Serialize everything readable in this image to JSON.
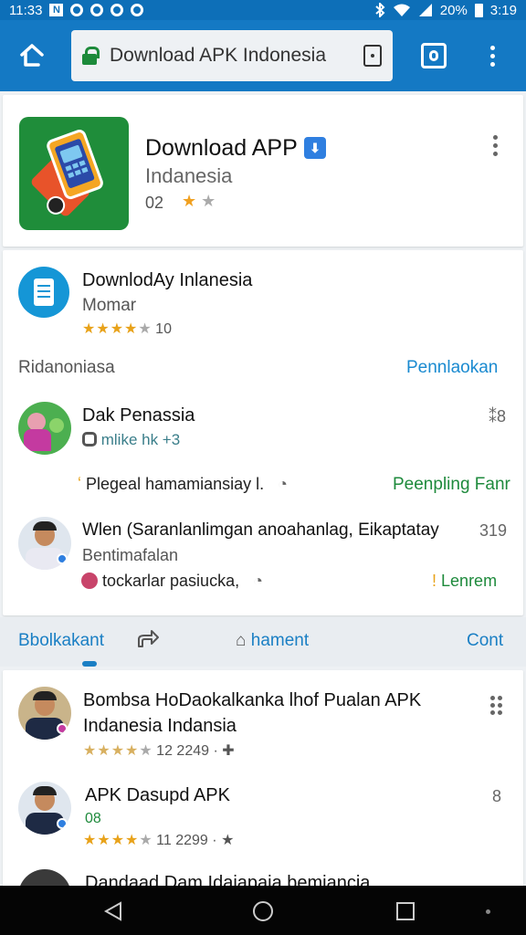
{
  "status_bar": {
    "time": "11:33",
    "app_initial": "N",
    "battery": "20%",
    "clock_right": "3:19"
  },
  "browser": {
    "url": "Download APK Indonesia"
  },
  "app_card": {
    "title": "Download APP",
    "subtitle": "Indanesia",
    "rating_num": "02"
  },
  "featured": {
    "title": "DownlodAy Inlanesia",
    "subtitle": "Momar",
    "rating": "10"
  },
  "section": {
    "label": "Ridanoniasa",
    "link": "Pennlaokan"
  },
  "reviews": [
    {
      "name": "Dak Penassia",
      "meta": "mlike hk +3",
      "count": "8",
      "reply": "Plegeal hamamiansiay l.",
      "link": "Peenpling Fanr"
    },
    {
      "name": "Wlen (Saranlanlimgan anoahanlag, Eikaptatay",
      "count": "319",
      "subtitle": "Bentimafalan",
      "reply": "tockarlar pasiucka,",
      "link": "Lenrem"
    }
  ],
  "actions": {
    "left": "Bbolkakant",
    "middle": "hament",
    "right": "Cont"
  },
  "apps": [
    {
      "title_line1": "Bombsa HoDaokalkanka lhof Pualan APK",
      "title_line2": "Indanesia Indansia",
      "stats": "12   2249"
    },
    {
      "title_line1": "APK Dasupd APK",
      "sub": "08",
      "count": "8",
      "stats": "11   2299"
    },
    {
      "title_line1": "Dandaad Dam Idaiapaia bemiancia"
    }
  ],
  "colors": {
    "toolbar": "#1479c4",
    "status_bar": "#0d6fb8",
    "link_blue": "#1a8ad0",
    "link_green": "#1e8a3c",
    "star_gold": "#e8a21a",
    "verified": "#2f7fe0",
    "app_icon_bg": "#1f8d3a"
  }
}
